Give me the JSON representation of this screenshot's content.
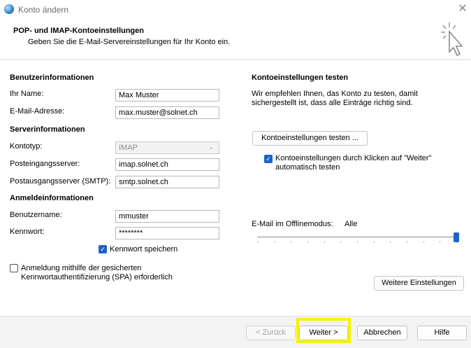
{
  "window": {
    "title": "Konto ändern",
    "close_label": "✕"
  },
  "header": {
    "title": "POP- und IMAP-Kontoeinstellungen",
    "subtitle": "Geben Sie die E-Mail-Servereinstellungen für Ihr Konto ein."
  },
  "left": {
    "user_section": "Benutzerinformationen",
    "name_label": "Ihr Name:",
    "name_value": "Max Muster",
    "email_label": "E-Mail-Adresse:",
    "email_value": "max.muster@solnet.ch",
    "server_section": "Serverinformationen",
    "account_type_label": "Kontotyp:",
    "account_type_value": "IMAP",
    "incoming_label": "Posteingangsserver:",
    "incoming_value": "imap.solnet.ch",
    "outgoing_label": "Postausgangsserver (SMTP):",
    "outgoing_value": "smtp.solnet.ch",
    "login_section": "Anmeldeinformationen",
    "username_label": "Benutzername:",
    "username_value": "mmuster",
    "password_label": "Kennwort:",
    "password_value": "********",
    "save_password_label": "Kennwort speichern",
    "save_password_checked": true,
    "spa_label_line1": "Anmeldung mithilfe der gesicherten",
    "spa_label_line2": "Kennwortauthentifizierung (SPA) erforderlich",
    "spa_checked": false
  },
  "right": {
    "test_section": "Kontoeinstellungen testen",
    "test_desc_line1": "Wir empfehlen Ihnen, das Konto zu testen, damit",
    "test_desc_line2": "sichergestellt ist, dass alle Einträge richtig sind.",
    "test_button": "Kontoeinstellungen testen ...",
    "auto_test_line1": "Kontoeinstellungen durch Klicken auf \"Weiter\"",
    "auto_test_line2": "automatisch testen",
    "auto_test_checked": true,
    "offline_label": "E-Mail im Offlinemodus:",
    "offline_value": "Alle",
    "offline_slider_level": 1.0,
    "more_settings_button": "Weitere Einstellungen"
  },
  "footer": {
    "back_button": "< Zurück",
    "next_button": "Weiter >",
    "cancel_button": "Abbrechen",
    "help_button": "Hilfe"
  },
  "colors": {
    "accent": "#1e64c8",
    "highlight": "#f6f200"
  }
}
